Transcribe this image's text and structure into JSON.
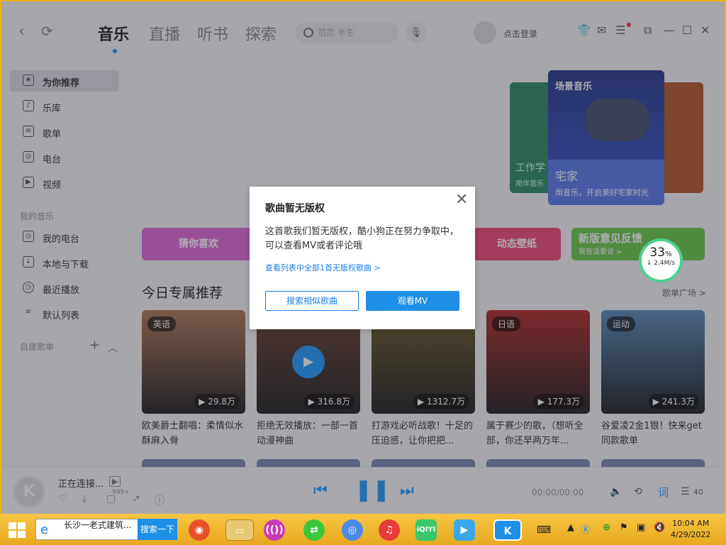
{
  "header": {
    "tabs": [
      "音乐",
      "直播",
      "听书",
      "探索"
    ],
    "search_placeholder": "范范 半生",
    "login_label": "点击登录"
  },
  "sidebar": {
    "items_top": [
      "为你推荐",
      "乐库",
      "歌单",
      "电台",
      "视频"
    ],
    "group_my_music": "我的音乐",
    "items_my": [
      "我的电台",
      "本地与下载",
      "最近播放",
      "默认列表"
    ],
    "group_custom": "自建歌单"
  },
  "banner": {
    "card_title": "场景音乐",
    "card_name": "宅家",
    "card_desc": "用音乐，开启美好宅家时光",
    "left_card_text": "工作学",
    "left_card_sub": "用伴音乐"
  },
  "pills": {
    "guess": "猜你喜欢",
    "wallpaper": "动态壁纸",
    "feedback": "新版意见反馈",
    "feedback_sub": "我有话要说 >"
  },
  "speed_widget": {
    "percent": "33",
    "unit": "%",
    "rate": "↓ 2.4M/s"
  },
  "section": {
    "title": "今日专属推荐",
    "more": "歌单广场 >"
  },
  "playlists": [
    {
      "tag": "英语",
      "plays": "▶ 29.8万",
      "title": "欧美爵士翻唱：柔情似水 酥麻入骨",
      "color": "#b07a5a"
    },
    {
      "tag": "",
      "plays": "▶ 316.8万",
      "title": "拒绝无效播放：一部一首动漫神曲",
      "color": "#6a4030"
    },
    {
      "tag": "",
      "plays": "▶ 1312.7万",
      "title": "打游戏必听战歌！十足的压迫感，让你把把...",
      "color": "#6b5a2a"
    },
    {
      "tag": "日语",
      "plays": "▶ 177.3万",
      "title": "属于赛少的歌，（想听全部，你还早两万年...",
      "color": "#b02a2a"
    },
    {
      "tag": "运动",
      "plays": "▶ 241.3万",
      "title": "谷爱凌2金1银！快来get同款歌单",
      "color": "#5a8ab8"
    }
  ],
  "player": {
    "status": "正在连接...",
    "badge": "999+",
    "time": "00:00/00:00",
    "lyric": "词",
    "list_count": "40"
  },
  "modal": {
    "title": "歌曲暂无版权",
    "body": "这首歌我们暂无版权，酷小狗正在努力争取中，可以查看MV或者评论哦",
    "link": "查看列表中全部1首无版权歌曲 >",
    "btn_similar": "搜索相似歌曲",
    "btn_mv": "观看MV"
  },
  "taskbar": {
    "search_text": "长沙一老式建筑...",
    "search_button": "搜索一下",
    "time": "10:04 AM",
    "date": "4/29/2022"
  }
}
